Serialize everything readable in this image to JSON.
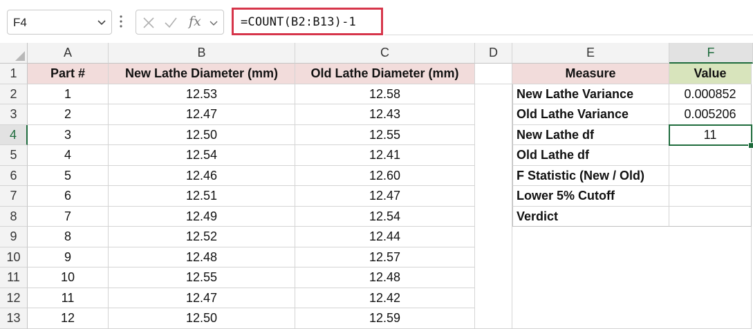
{
  "formula_bar": {
    "name_box": "F4",
    "formula": "=COUNT(B2:B13)-1",
    "cancel_icon": "x-icon",
    "enter_icon": "check-icon",
    "function_icon": "fx-icon",
    "fx_label": "fx"
  },
  "columns": [
    "A",
    "B",
    "C",
    "D",
    "E",
    "F"
  ],
  "rows": [
    "1",
    "2",
    "3",
    "4",
    "5",
    "6",
    "7",
    "8",
    "9",
    "10",
    "11",
    "12",
    "13"
  ],
  "active_cell": {
    "column": "F",
    "row": "4"
  },
  "table": {
    "headers": [
      "Part #",
      "New Lathe Diameter (mm)",
      "Old Lathe Diameter (mm)"
    ],
    "data": [
      [
        "1",
        "12.53",
        "12.58"
      ],
      [
        "2",
        "12.47",
        "12.43"
      ],
      [
        "3",
        "12.50",
        "12.55"
      ],
      [
        "4",
        "12.54",
        "12.41"
      ],
      [
        "5",
        "12.46",
        "12.60"
      ],
      [
        "6",
        "12.51",
        "12.47"
      ],
      [
        "7",
        "12.49",
        "12.54"
      ],
      [
        "8",
        "12.52",
        "12.44"
      ],
      [
        "9",
        "12.48",
        "12.57"
      ],
      [
        "10",
        "12.55",
        "12.48"
      ],
      [
        "11",
        "12.47",
        "12.42"
      ],
      [
        "12",
        "12.50",
        "12.59"
      ]
    ]
  },
  "summary": {
    "headers": [
      "Measure",
      "Value"
    ],
    "rows": [
      [
        "New Lathe Variance",
        "0.000852"
      ],
      [
        "Old Lathe Variance",
        "0.005206"
      ],
      [
        "New Lathe df",
        "11"
      ],
      [
        "Old Lathe df",
        ""
      ],
      [
        "F Statistic (New / Old)",
        ""
      ],
      [
        "Lower 5% Cutoff",
        ""
      ],
      [
        "Verdict",
        ""
      ]
    ]
  },
  "colors": {
    "header_pink": "#f2dcdb",
    "header_green": "#d8e4bc",
    "selection": "#1e6b3c",
    "formula_highlight": "#d6354a"
  }
}
